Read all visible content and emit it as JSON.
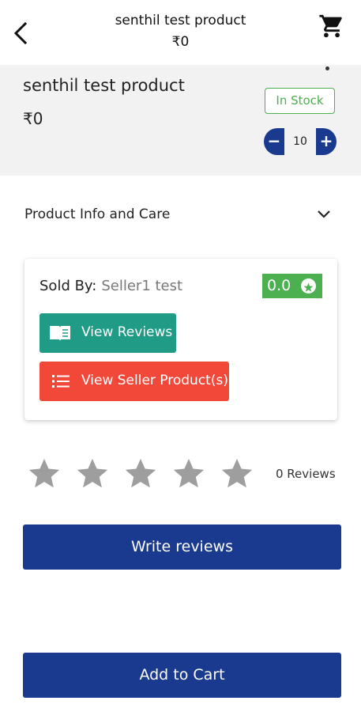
{
  "header": {
    "title": "senthil test product",
    "price": "₹0",
    "back_icon": "back-arrow-icon",
    "cart_icon": "shopping-cart-icon"
  },
  "summary": {
    "product_name": "senthil test product",
    "price": "₹0",
    "stock_status": "In Stock",
    "quantity": "10",
    "decrement_label": "−",
    "increment_label": "+"
  },
  "info": {
    "label": "Product Info and Care",
    "chevron_icon": "chevron-down-icon"
  },
  "seller": {
    "sold_by_label": "Sold By:",
    "seller_name": "Seller1 test",
    "rating": "0.0",
    "view_reviews_label": "View Reviews",
    "view_products_label": "View Seller Product(s)"
  },
  "reviews": {
    "star_rating": 0,
    "star_max": 5,
    "count_label": "0 Reviews",
    "write_label": "Write reviews"
  },
  "actions": {
    "add_to_cart_label": "Add to Cart"
  },
  "colors": {
    "primary": "#1a3a8f",
    "success": "#4caf50",
    "teal": "#1f9b86",
    "danger": "#f2483a",
    "star_empty": "#9e9e9e"
  }
}
